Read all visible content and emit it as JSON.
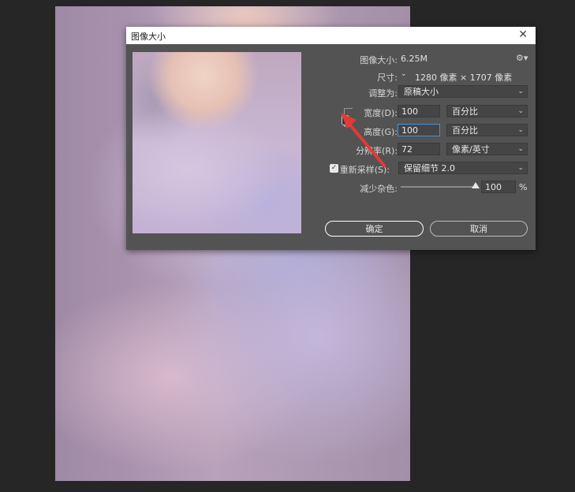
{
  "dialog": {
    "title": "图像大小",
    "size_label": "图像大小:",
    "size_value": "6.25M",
    "dimensions_label": "尺寸:",
    "dimensions_value": "1280 像素 × 1707 像素",
    "fit_label": "调整为:",
    "fit_value": "原稿大小",
    "width_label": "宽度(D):",
    "width_value": "100",
    "width_unit": "百分比",
    "height_label": "高度(G):",
    "height_value": "100",
    "height_unit": "百分比",
    "resolution_label": "分辨率(R):",
    "resolution_value": "72",
    "resolution_unit": "像素/英寸",
    "resample_label": "重新采样(S):",
    "resample_checked": true,
    "resample_value": "保留细节 2.0",
    "noise_label": "减少杂色:",
    "noise_value": "100",
    "noise_unit": "%",
    "noise_level": 1.0,
    "ok_label": "确定",
    "cancel_label": "取消"
  },
  "colors": {
    "dialog_bg": "#535353",
    "annotation_arrow": "#e53935",
    "focus": "#4a90d9"
  }
}
